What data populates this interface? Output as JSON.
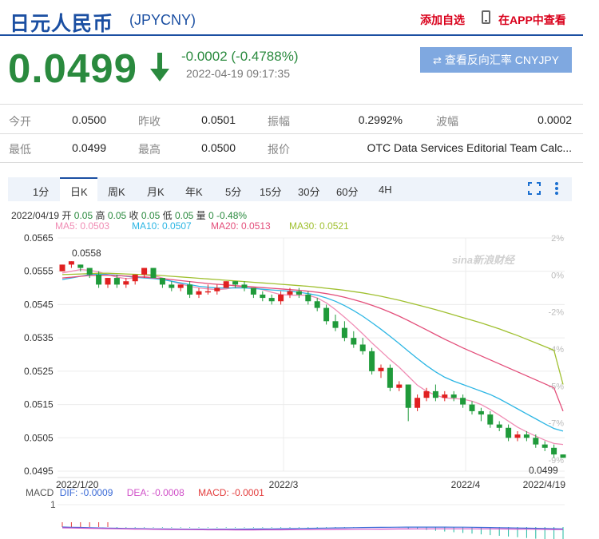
{
  "header": {
    "title": "日元人民币",
    "code": "(JPYCNY)",
    "add_watch": "添加自选",
    "app_view": "在APP中查看"
  },
  "quote": {
    "price": "0.0499",
    "change": "-0.0002 (-0.4788%)",
    "time": "2022-04-19 09:17:35",
    "reverse_btn": "查看反向汇率 CNYJPY",
    "reverse_icon": "swap-icon",
    "direction_icon": "down-arrow-icon",
    "color_down": "#2a8a3e"
  },
  "stats": [
    {
      "label": "今开",
      "value": "0.0500"
    },
    {
      "label": "昨收",
      "value": "0.0501"
    },
    {
      "label": "振幅",
      "value": "0.2992%"
    },
    {
      "label": "波幅",
      "value": "0.0002"
    },
    {
      "label": "最低",
      "value": "0.0499"
    },
    {
      "label": "最高",
      "value": "0.0500"
    },
    {
      "label": "报价",
      "value": "OTC Data Services Editorial Team Calc..."
    }
  ],
  "tabs": [
    "1分",
    "日K",
    "周K",
    "月K",
    "年K",
    "5分",
    "15分",
    "30分",
    "60分",
    "4H"
  ],
  "active_tab": "日K",
  "ohlc_line": {
    "date": "2022/04/19",
    "open_label": "开",
    "open": "0.05",
    "high_label": "高",
    "high": "0.05",
    "close_label": "收",
    "close": "0.05",
    "low_label": "低",
    "low": "0.05",
    "vol_label": "量",
    "vol": "0",
    "pct": "-0.48%"
  },
  "ma_legend": [
    {
      "text": "MA5: 0.0503",
      "color": "#f08cb4"
    },
    {
      "text": "MA10: 0.0507",
      "color": "#2cb6e4"
    },
    {
      "text": "MA20: 0.0513",
      "color": "#e34e7a"
    },
    {
      "text": "MA30: 0.0521",
      "color": "#a0c030"
    }
  ],
  "macd_legend": {
    "name": "MACD",
    "dif": "DIF: -0.0009",
    "dea": "DEA: -0.0008",
    "macd": "MACD: -0.0001",
    "axis_label": "1"
  },
  "watermark": "sina新浪财经",
  "chart_data": {
    "type": "candlestick",
    "yticks": [
      "0.0565",
      "0.0555",
      "0.0545",
      "0.0535",
      "0.0525",
      "0.0515",
      "0.0505",
      "0.0495"
    ],
    "ylim": [
      0.0495,
      0.0565
    ],
    "pct_ticks": [
      "2%",
      "0%",
      "-2%",
      "-4%",
      "-5%",
      "-7%",
      "-9%"
    ],
    "x_labels": [
      "2022/1/20",
      "2022/3",
      "2022/4",
      "2022/4/19"
    ],
    "max_label": "0.0558",
    "min_label": "0.0499",
    "colors": {
      "up": "#e02020",
      "down": "#1f9a3a"
    },
    "candles": [
      [
        0.0555,
        0.0557,
        0.0555,
        0.0557
      ],
      [
        0.0557,
        0.0558,
        0.0556,
        0.0558
      ],
      [
        0.0557,
        0.0557,
        0.0555,
        0.0556
      ],
      [
        0.0556,
        0.0556,
        0.0553,
        0.0554
      ],
      [
        0.0554,
        0.0555,
        0.055,
        0.0551
      ],
      [
        0.0551,
        0.0553,
        0.055,
        0.0553
      ],
      [
        0.0553,
        0.0554,
        0.055,
        0.0551
      ],
      [
        0.0551,
        0.0553,
        0.055,
        0.0552
      ],
      [
        0.0552,
        0.0554,
        0.0551,
        0.0554
      ],
      [
        0.0554,
        0.0556,
        0.0553,
        0.0556
      ],
      [
        0.0556,
        0.0556,
        0.0553,
        0.0553
      ],
      [
        0.0553,
        0.0553,
        0.055,
        0.0551
      ],
      [
        0.0551,
        0.0552,
        0.0549,
        0.055
      ],
      [
        0.055,
        0.0551,
        0.0549,
        0.0551
      ],
      [
        0.0551,
        0.0552,
        0.0547,
        0.0548
      ],
      [
        0.0548,
        0.055,
        0.0547,
        0.0549
      ],
      [
        0.0549,
        0.0551,
        0.0548,
        0.0549
      ],
      [
        0.0549,
        0.0551,
        0.0548,
        0.055
      ],
      [
        0.055,
        0.0552,
        0.055,
        0.0552
      ],
      [
        0.0552,
        0.0552,
        0.055,
        0.0551
      ],
      [
        0.0551,
        0.0552,
        0.0549,
        0.055
      ],
      [
        0.055,
        0.055,
        0.0547,
        0.0548
      ],
      [
        0.0548,
        0.0549,
        0.0546,
        0.0547
      ],
      [
        0.0547,
        0.0548,
        0.0545,
        0.0546
      ],
      [
        0.0546,
        0.0549,
        0.0545,
        0.0548
      ],
      [
        0.0548,
        0.055,
        0.0547,
        0.0549
      ],
      [
        0.0549,
        0.055,
        0.0547,
        0.0548
      ],
      [
        0.0548,
        0.0549,
        0.0545,
        0.0546
      ],
      [
        0.0546,
        0.0547,
        0.0543,
        0.0544
      ],
      [
        0.0544,
        0.0545,
        0.0539,
        0.054
      ],
      [
        0.054,
        0.0542,
        0.0537,
        0.0538
      ],
      [
        0.0538,
        0.054,
        0.0534,
        0.0535
      ],
      [
        0.0535,
        0.0537,
        0.0532,
        0.0533
      ],
      [
        0.0533,
        0.0535,
        0.053,
        0.0531
      ],
      [
        0.0531,
        0.0532,
        0.0524,
        0.0525
      ],
      [
        0.0525,
        0.0527,
        0.0523,
        0.0526
      ],
      [
        0.0526,
        0.0527,
        0.0519,
        0.052
      ],
      [
        0.052,
        0.0522,
        0.0519,
        0.0521
      ],
      [
        0.0521,
        0.0521,
        0.051,
        0.0514
      ],
      [
        0.0514,
        0.0518,
        0.0513,
        0.0517
      ],
      [
        0.0517,
        0.052,
        0.0516,
        0.0519
      ],
      [
        0.0519,
        0.0521,
        0.0516,
        0.0517
      ],
      [
        0.0517,
        0.0519,
        0.0516,
        0.0518
      ],
      [
        0.0518,
        0.0519,
        0.0516,
        0.0517
      ],
      [
        0.0517,
        0.0518,
        0.0514,
        0.0515
      ],
      [
        0.0515,
        0.0516,
        0.0512,
        0.0513
      ],
      [
        0.0513,
        0.0514,
        0.051,
        0.0512
      ],
      [
        0.0512,
        0.0513,
        0.0508,
        0.0509
      ],
      [
        0.0509,
        0.051,
        0.0507,
        0.0508
      ],
      [
        0.0508,
        0.0509,
        0.0504,
        0.0505
      ],
      [
        0.0505,
        0.0507,
        0.0504,
        0.0506
      ],
      [
        0.0506,
        0.0507,
        0.0504,
        0.0505
      ],
      [
        0.0505,
        0.0506,
        0.0502,
        0.0503
      ],
      [
        0.0503,
        0.0504,
        0.0501,
        0.0502
      ],
      [
        0.0502,
        0.0503,
        0.0499,
        0.05
      ],
      [
        0.05,
        0.05,
        0.0499,
        0.0499
      ]
    ],
    "ma": {
      "MA5": [
        0.05545,
        0.0555,
        0.05555,
        0.05553,
        0.05548,
        0.0554,
        0.05532,
        0.05528,
        0.0553,
        0.05534,
        0.05537,
        0.0553,
        0.0552,
        0.05512,
        0.05505,
        0.055,
        0.05497,
        0.05495,
        0.05497,
        0.05502,
        0.05504,
        0.05501,
        0.05495,
        0.05487,
        0.0548,
        0.05478,
        0.05478,
        0.05478,
        0.0547,
        0.05455,
        0.05435,
        0.05412,
        0.05388,
        0.05362,
        0.05335,
        0.0531,
        0.05285,
        0.05262,
        0.05235,
        0.05208,
        0.0519,
        0.05178,
        0.0517,
        0.05168,
        0.05166,
        0.0516,
        0.0515,
        0.05135,
        0.05118,
        0.051,
        0.05082,
        0.05068,
        0.05055,
        0.05043,
        0.05033,
        0.0503
      ],
      "MA10": [
        0.05525,
        0.0553,
        0.05535,
        0.0554,
        0.05542,
        0.0554,
        0.05538,
        0.05535,
        0.05532,
        0.0553,
        0.05528,
        0.05525,
        0.0552,
        0.05515,
        0.0551,
        0.05505,
        0.05502,
        0.055,
        0.055,
        0.055,
        0.055,
        0.05498,
        0.05496,
        0.05494,
        0.05492,
        0.0549,
        0.05487,
        0.05483,
        0.05478,
        0.0547,
        0.0546,
        0.05447,
        0.05432,
        0.05415,
        0.05396,
        0.05376,
        0.05355,
        0.05333,
        0.0531,
        0.05288,
        0.05267,
        0.05248,
        0.05232,
        0.0522,
        0.0521,
        0.052,
        0.0519,
        0.0518,
        0.05167,
        0.05152,
        0.05137,
        0.05122,
        0.05107,
        0.05092,
        0.05078,
        0.0507
      ],
      "MA20": [
        0.0553,
        0.05532,
        0.05535,
        0.05537,
        0.05538,
        0.05538,
        0.05537,
        0.05536,
        0.05534,
        0.05532,
        0.0553,
        0.05528,
        0.05525,
        0.05522,
        0.05519,
        0.05516,
        0.05513,
        0.05511,
        0.05509,
        0.05507,
        0.05505,
        0.05503,
        0.05501,
        0.05499,
        0.05497,
        0.05495,
        0.05493,
        0.0549,
        0.05487,
        0.05483,
        0.05478,
        0.05472,
        0.05465,
        0.05457,
        0.05448,
        0.05438,
        0.05427,
        0.05415,
        0.05402,
        0.05388,
        0.05374,
        0.0536,
        0.05346,
        0.05333,
        0.0532,
        0.05308,
        0.05296,
        0.05284,
        0.05272,
        0.0526,
        0.05248,
        0.05236,
        0.05224,
        0.05212,
        0.052,
        0.0513
      ],
      "MA30": [
        0.0554,
        0.05541,
        0.05542,
        0.05543,
        0.05544,
        0.05544,
        0.05543,
        0.05542,
        0.05541,
        0.0554,
        0.05539,
        0.05537,
        0.05535,
        0.05533,
        0.05531,
        0.05529,
        0.05527,
        0.05525,
        0.05523,
        0.05521,
        0.05519,
        0.05517,
        0.05515,
        0.05513,
        0.05511,
        0.05509,
        0.05507,
        0.05505,
        0.05502,
        0.05499,
        0.05496,
        0.05493,
        0.05489,
        0.05485,
        0.0548,
        0.05475,
        0.05469,
        0.05463,
        0.05456,
        0.05449,
        0.05442,
        0.05435,
        0.05427,
        0.05419,
        0.05411,
        0.05403,
        0.05395,
        0.05386,
        0.05377,
        0.05367,
        0.05357,
        0.05346,
        0.05335,
        0.05324,
        0.05313,
        0.0521
      ]
    }
  }
}
